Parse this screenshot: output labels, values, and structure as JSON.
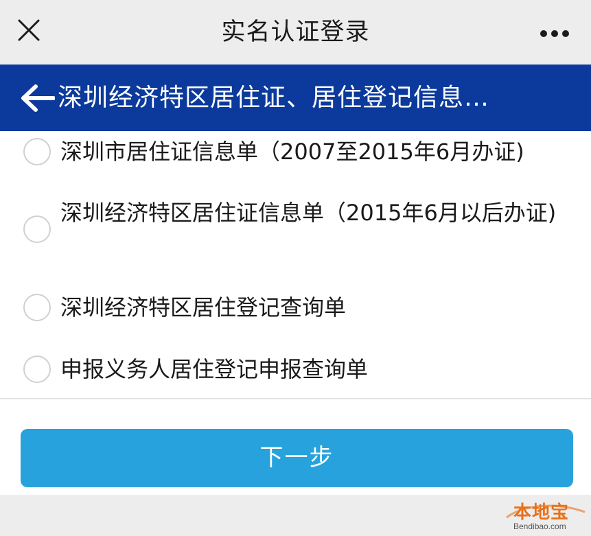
{
  "header": {
    "title": "实名认证登录"
  },
  "nav": {
    "section_title": "深圳经济特区居住证、居住登记信息…"
  },
  "options": [
    {
      "label": "深圳市居住证信息单（2007至2015年6月办证)",
      "selected": false
    },
    {
      "label": "深圳经济特区居住证信息单（2015年6月以后办证)",
      "selected": false
    },
    {
      "label": "深圳经济特区居住登记查询单",
      "selected": false
    },
    {
      "label": "申报义务人居住登记申报查询单",
      "selected": false
    }
  ],
  "footer": {
    "next_label": "下一步"
  },
  "watermark": {
    "name": "本地宝",
    "url": "Bendibao.com"
  },
  "colors": {
    "nav_band": "#0b3a9c",
    "primary_button": "#27a2dc",
    "watermark": "#e8711a"
  },
  "icons": {
    "close": "close-icon",
    "more": "more-icon",
    "back": "back-arrow-icon",
    "radio": "radio-unchecked-icon"
  }
}
